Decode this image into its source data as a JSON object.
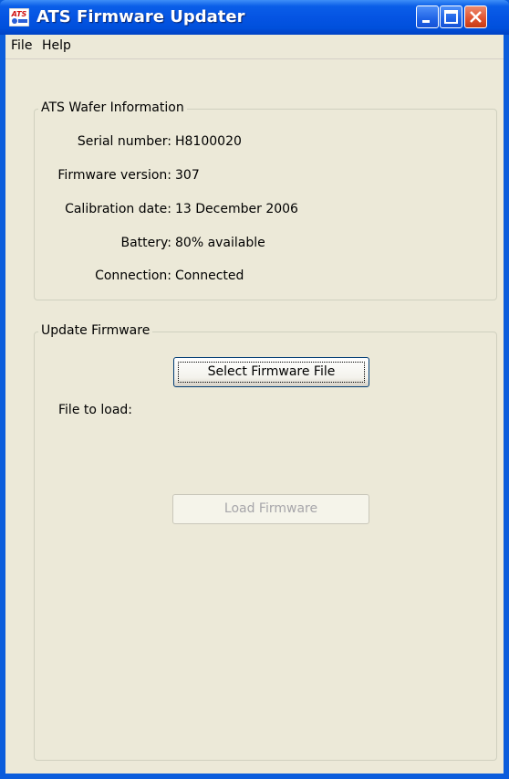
{
  "window": {
    "title": "ATS Firmware Updater",
    "icon": "ats-app-icon",
    "icon_text": "ATS",
    "controls": [
      "minimize-icon",
      "maximize-icon",
      "close-icon"
    ],
    "titlebar_color": "#0554e3",
    "close_color": "#e0512e"
  },
  "menu": {
    "file_label": "File",
    "help_label": "Help"
  },
  "wafer_info": {
    "group_title": "ATS Wafer Information",
    "rows": [
      {
        "label": "Serial number:",
        "value": "H8100020"
      },
      {
        "label": "Firmware version:",
        "value": "307"
      },
      {
        "label": "Calibration date:",
        "value": "13 December 2006"
      },
      {
        "label": "Battery:",
        "value": "80% available"
      },
      {
        "label": "Connection:",
        "value": "Connected"
      }
    ]
  },
  "update": {
    "group_title": "Update Firmware",
    "select_button_label": "Select Firmware File",
    "file_to_load_label": "File to load:",
    "load_button_label": "Load Firmware",
    "load_button_enabled": false
  }
}
